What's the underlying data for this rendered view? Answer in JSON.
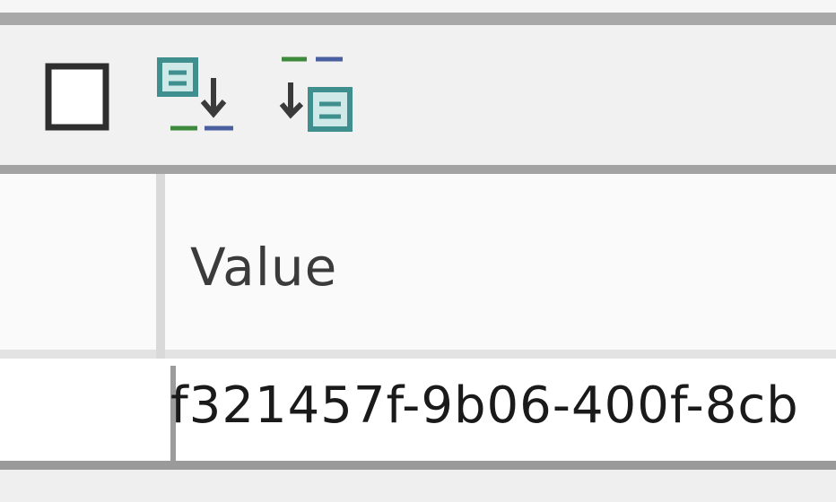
{
  "toolbar": {
    "buttons": [
      {
        "name": "checkbox",
        "icon": "checkbox-icon"
      },
      {
        "name": "move-down",
        "icon": "move-down-icon"
      },
      {
        "name": "move-up",
        "icon": "move-up-icon"
      }
    ]
  },
  "grid": {
    "columns": [
      "",
      "Value"
    ],
    "rows": [
      {
        "name": "",
        "value": "f321457f-9b06-400f-8cb"
      }
    ]
  },
  "colors": {
    "icon_teal": "#3f8f8f",
    "icon_blue": "#4a5fa0",
    "icon_green": "#3d8a3d"
  }
}
